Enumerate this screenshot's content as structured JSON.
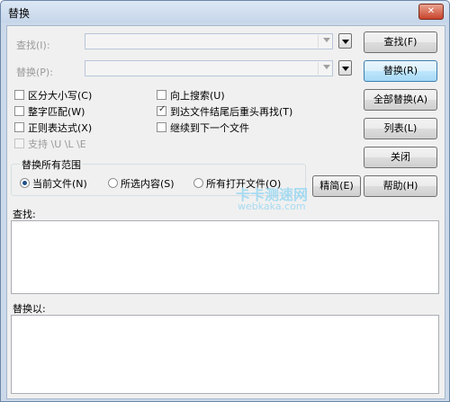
{
  "window": {
    "title": "替换",
    "close_glyph": "✕"
  },
  "find": {
    "label": "查找(I):",
    "value": ""
  },
  "replace": {
    "label": "替换(P):",
    "value": ""
  },
  "options": {
    "match_case": {
      "label": "区分大小写(C)",
      "checked": false
    },
    "whole_word": {
      "label": "整字匹配(W)",
      "checked": false
    },
    "regex": {
      "label": "正则表达式(X)",
      "checked": false
    },
    "support_escapes": {
      "label": "支持 \\U \\L \\E",
      "checked": false,
      "disabled": true
    },
    "search_up": {
      "label": "向上搜索(U)",
      "checked": false
    },
    "wrap_around": {
      "label": "到达文件结尾后重头再找(T)",
      "checked": true
    },
    "continue_next": {
      "label": "继续到下一个文件",
      "checked": false
    }
  },
  "scope": {
    "title": "替换所有范围",
    "options": [
      "当前文件(N)",
      "所选内容(S)",
      "所有打开文件(O)"
    ],
    "selected": "当前文件(N)"
  },
  "buttons": {
    "find": "查找(F)",
    "replace": "替换(R)",
    "replace_all": "全部替换(A)",
    "list": "列表(L)",
    "close": "关闭",
    "simplify": "精简(E)",
    "help": "帮助(H)"
  },
  "panes": {
    "find_label": "查找:",
    "replace_label": "替换以:"
  },
  "watermark": {
    "line1": "卡卡测速网",
    "line2": "webkaka.com"
  }
}
